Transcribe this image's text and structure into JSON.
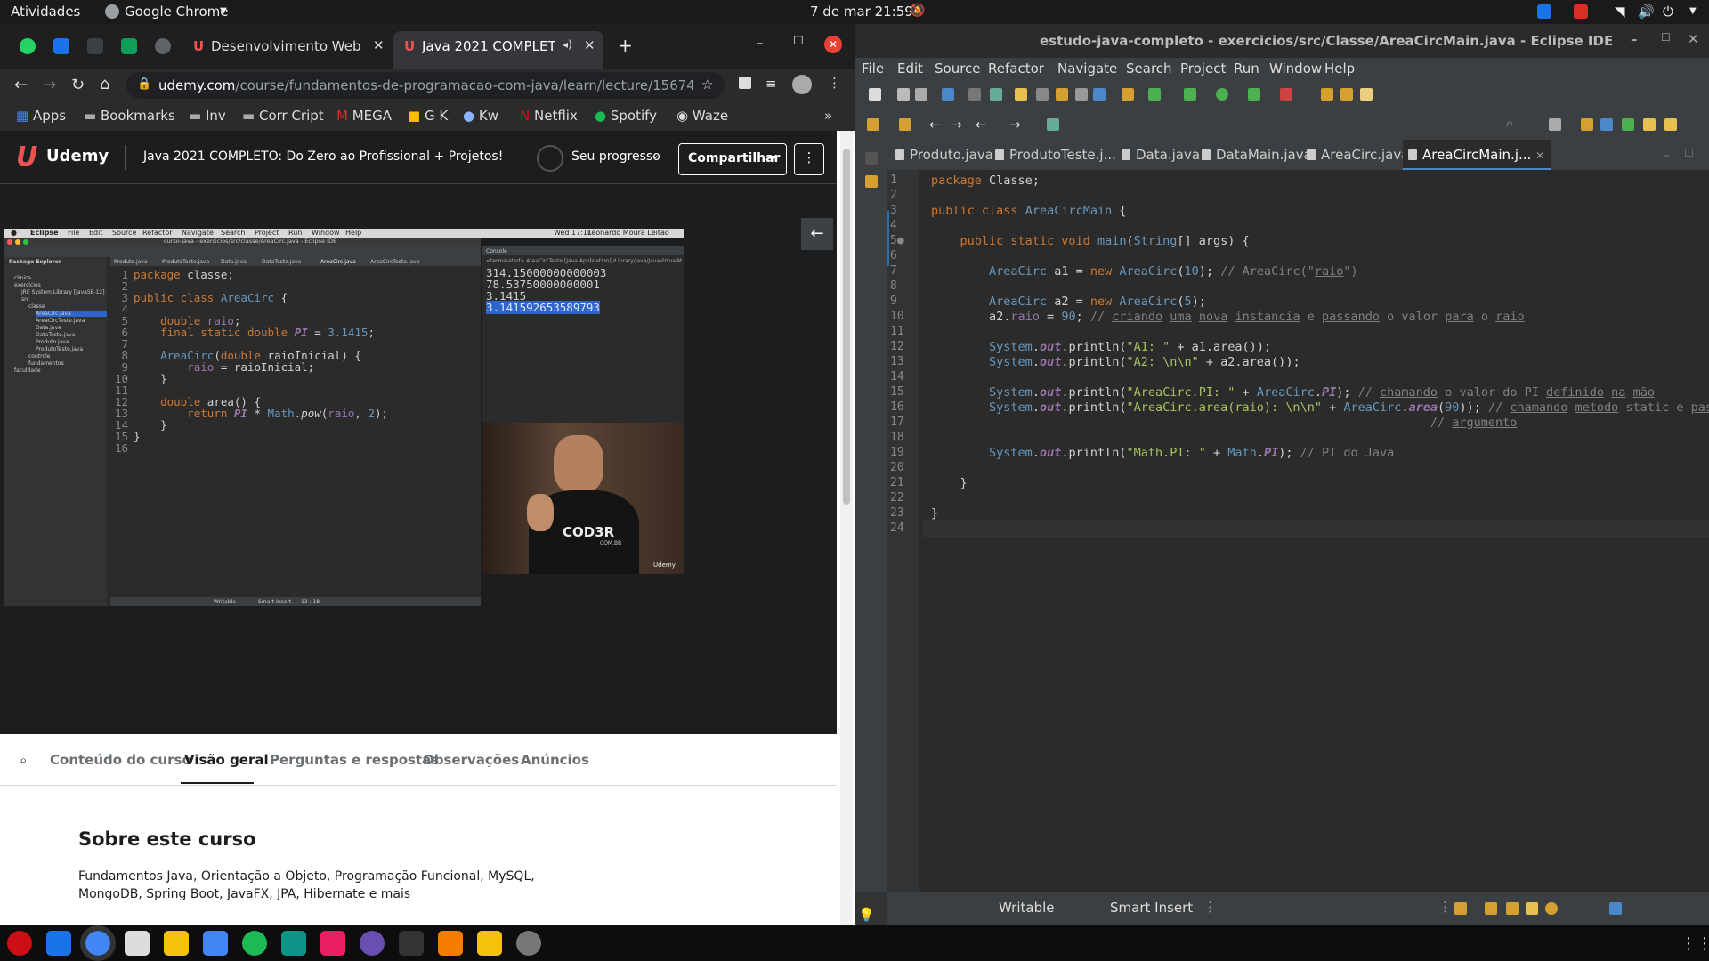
{
  "topbar": {
    "activities": "Atividades",
    "app": "Google Chrome",
    "datetime": "7 de mar  21:59"
  },
  "chrome": {
    "tabs": [
      {
        "label": "Desenvolvimento Web Fu"
      },
      {
        "label": "Java 2021 COMPLETO"
      }
    ],
    "url_host": "udemy.com",
    "url_path": "/course/fundamentos-de-programacao-com-java/learn/lecture/15674536#overview",
    "bookmarks": [
      "Apps",
      "Bookmarks",
      "Inv",
      "Corr Cript",
      "MEGA",
      "G K",
      "Kw",
      "Netflix",
      "Spotify",
      "Waze"
    ]
  },
  "udemy": {
    "logo": "Udemy",
    "course_title": "Java 2021 COMPLETO: Do Zero ao Profissional + Projetos!",
    "progress": "Seu progresso",
    "share": "Compartilhar",
    "tabs": [
      "Conteúdo do curso",
      "Visão geral",
      "Perguntas e respostas",
      "Observações",
      "Anúncios"
    ],
    "active_tab": "Visão geral",
    "section_title": "Sobre este curso",
    "description_line1": "Fundamentos Java, Orientação a Objeto, Programação Funcional, MySQL,",
    "description_line2": "MongoDB, Spring Boot, JavaFX, JPA, Hibernate e mais"
  },
  "video": {
    "mac_menu": [
      "Eclipse",
      "File",
      "Edit",
      "Source",
      "Refactor",
      "Navigate",
      "Search",
      "Project",
      "Run",
      "Window",
      "Help"
    ],
    "mac_clock": "Wed 17:11",
    "mac_user": "Leonardo Moura Leitão",
    "window_title": "curso-java - exercicios/src/classe/AreaCirc.java - Eclipse IDE",
    "package_explorer": "Package Explorer",
    "console_title": "Console",
    "tabs": [
      "Produto.java",
      "ProdutoTeste.java",
      "Data.java",
      "DataTeste.java",
      "AreaCirc.java",
      "AreaCircTeste.java"
    ],
    "tree": [
      "clínica",
      "exercicios",
      "JRE System Library [JavaSE-12]",
      "src",
      "classe",
      "AreaCirc.java",
      "AreaCircTeste.java",
      "Data.java",
      "DataTeste.java",
      "Produto.java",
      "ProdutoTeste.java",
      "controle",
      "fundamentos",
      "faculdade"
    ],
    "code": [
      "package classe;",
      "",
      "public class AreaCirc {",
      "",
      "    double raio;",
      "    final static double PI = 3.1415;",
      "",
      "    AreaCirc(double raioInicial) {",
      "        raio = raioInicial;",
      "    }",
      "",
      "    double area() {",
      "        return PI * Math.pow(raio, 2);",
      "    }",
      "}",
      ""
    ],
    "console_header": "<terminated> AreaCircTeste [Java Application] /Library/Java/JavaVirtualMachines/jdk-1",
    "console_output": [
      "314.15000000000003",
      "78.53750000000001",
      "3.1415",
      "3.141592653589793"
    ],
    "status": [
      "Writable",
      "Smart Insert",
      "13 : 18"
    ],
    "watermark": "COD3R",
    "watermark_sub": "COM.BR",
    "udemy_watermark": "Udemy"
  },
  "eclipse": {
    "title": "estudo-java-completo - exercicios/src/Classe/AreaCircMain.java - Eclipse IDE",
    "menu": [
      "File",
      "Edit",
      "Source",
      "Refactor",
      "Navigate",
      "Search",
      "Project",
      "Run",
      "Window",
      "Help"
    ],
    "tabs": [
      "Produto.java",
      "ProdutoTeste.j...",
      "Data.java",
      "DataMain.java",
      "AreaCirc.java",
      "AreaCircMain.j..."
    ],
    "active_tab": "AreaCircMain.j...",
    "line_count": 24,
    "status_writable": "Writable",
    "status_insert": "Smart Insert"
  },
  "colors": {
    "udemy_brand": "#a435f0",
    "eclipse_bg": "#2b2b2b",
    "chrome_bg": "#202124"
  }
}
